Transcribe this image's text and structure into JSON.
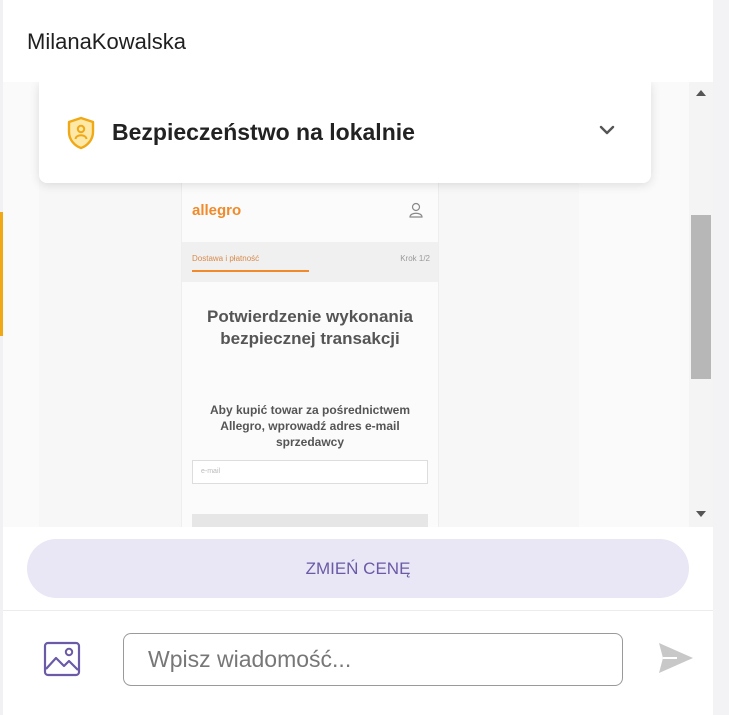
{
  "header": {
    "contact_name": "MilanaKowalska"
  },
  "safety_banner": {
    "title": "Bezpieczeństwo na lokalnie",
    "icon": "shield-user-icon",
    "expand_icon": "chevron-down-icon"
  },
  "attachment": {
    "brand": "allegro",
    "step_label": "Dostawa i płatność",
    "step_counter": "Krok 1/2",
    "heading": "Potwierdzenie wykonania bezpiecznej transakcji",
    "description": "Aby kupić towar za pośrednictwem Allegro, wprowadź adres e-mail sprzedawcy",
    "email_placeholder": "e-mail"
  },
  "actions": {
    "change_price_label": "ZMIEŃ CENĘ"
  },
  "composer": {
    "placeholder": "Wpisz wiadomość...",
    "value": "",
    "attach_icon": "image-icon",
    "send_icon": "send-icon"
  },
  "colors": {
    "accent": "#f0a814",
    "change_price_bg": "#e9e6f5",
    "change_price_text": "#6b5aa6",
    "brand_allegro": "#f08a2a"
  }
}
